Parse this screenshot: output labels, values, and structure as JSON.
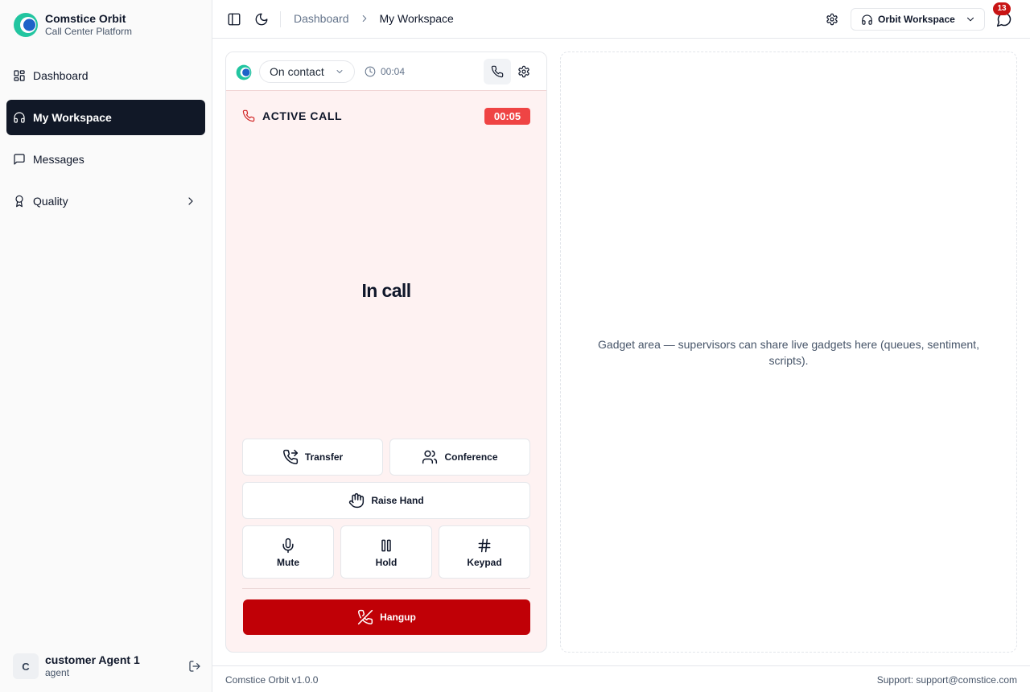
{
  "brand": {
    "name": "Comstice Orbit",
    "subtitle": "Call Center Platform"
  },
  "sidebar": {
    "items": [
      {
        "label": "Dashboard",
        "icon": "dashboard-grid-icon",
        "active": false
      },
      {
        "label": "My Workspace",
        "icon": "headphones-icon",
        "active": true
      },
      {
        "label": "Messages",
        "icon": "message-square-icon",
        "active": false
      },
      {
        "label": "Quality",
        "icon": "award-icon",
        "active": false,
        "has_children": true
      }
    ]
  },
  "user": {
    "initial": "C",
    "name": "customer Agent 1",
    "role": "agent"
  },
  "header": {
    "breadcrumb": [
      "Dashboard",
      "My Workspace"
    ],
    "workspace_selector": "Orbit Workspace",
    "notification_count": "13"
  },
  "phone": {
    "status": "On contact",
    "status_timer": "00:04",
    "active_call_label": "ACTIVE CALL",
    "call_timer": "00:05",
    "state_text": "In call",
    "buttons": {
      "transfer": "Transfer",
      "conference": "Conference",
      "raise_hand": "Raise Hand",
      "mute": "Mute",
      "hold": "Hold",
      "keypad": "Keypad",
      "hangup": "Hangup"
    }
  },
  "gadget": {
    "text": "Gadget area — supervisors can share live gadgets here (queues, sentiment, scripts)."
  },
  "footer": {
    "version": "Comstice Orbit v1.0.0",
    "support": "Support: support@comstice.com"
  },
  "colors": {
    "primary_dark": "#111827",
    "hangup_red": "#c00006",
    "timer_red": "#ef4444",
    "badge_red": "#c81414",
    "panel_bg": "#fef2f2",
    "brand_teal": "#22c5a0",
    "brand_blue": "#1e63c8"
  }
}
